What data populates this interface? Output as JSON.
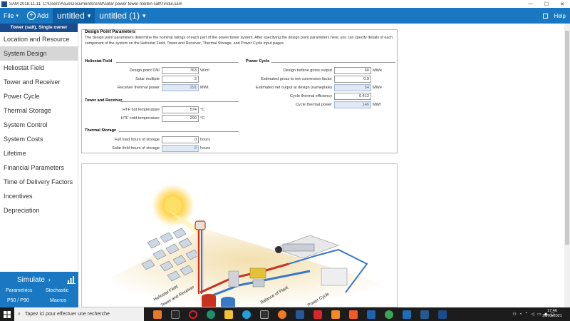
{
  "window": {
    "title": "SAM 2018.11.11: C:\\Users\\Asus\\Documents\\SAM\\solar power tower meiten salt\\Tiridul.sam"
  },
  "menubar": {
    "file_label": "File",
    "add_label": "Add",
    "cases": [
      "untitled",
      "untitled (1)"
    ],
    "help_label": "Help"
  },
  "sidebar": {
    "config_label": "Tower (salt), Single owner",
    "items": [
      {
        "label": "Location and Resource"
      },
      {
        "label": "System Design"
      },
      {
        "label": "Heliostat Field"
      },
      {
        "label": "Tower and Receiver"
      },
      {
        "label": "Power Cycle"
      },
      {
        "label": "Thermal Storage"
      },
      {
        "label": "System Control"
      },
      {
        "label": "System Costs"
      },
      {
        "label": "Lifetime"
      },
      {
        "label": "Financial Parameters"
      },
      {
        "label": "Time of Delivery Factors"
      },
      {
        "label": "Incentives"
      },
      {
        "label": "Depreciation"
      }
    ],
    "simulate_label": "Simulate",
    "parametrics_label": "Parametrics",
    "stochastic_label": "Stochastic",
    "p50p90_label": "P50 / P90",
    "macros_label": "Macros"
  },
  "design_point": {
    "title": "Design Point Parameters",
    "description": "The design point parameters determine the nominal ratings of each part of the power tower system. After specifying the design point parameters here, you can specify details of each component of the system on the Heliostat Field, Tower and Receiver, Thermal Storage, and Power Cycle input pages.",
    "heliostat_field": {
      "title": "Heliostat Field",
      "rows": [
        {
          "label": "Design point DNI",
          "value": "763",
          "unit": "W/m²",
          "calc": false
        },
        {
          "label": "Solar multiple",
          "value": "2",
          "unit": "",
          "calc": false
        },
        {
          "label": "Receiver thermal power",
          "value": "291",
          "unit": "MWt",
          "calc": true
        }
      ]
    },
    "tower_receiver": {
      "title": "Tower and Receiver",
      "rows": [
        {
          "label": "HTF hot temperature",
          "value": "574",
          "unit": "°C",
          "calc": false
        },
        {
          "label": "HTF cold temperature",
          "value": "290",
          "unit": "°C",
          "calc": false
        }
      ]
    },
    "thermal_storage": {
      "title": "Thermal Storage",
      "rows": [
        {
          "label": "Full load hours of storage",
          "value": "0",
          "unit": "hours",
          "calc": false
        },
        {
          "label": "Solar field hours of storage",
          "value": "0",
          "unit": "hours",
          "calc": true
        }
      ]
    },
    "power_cycle": {
      "title": "Power Cycle",
      "rows": [
        {
          "label": "Design turbine gross output",
          "value": "60",
          "unit": "MWe",
          "calc": false
        },
        {
          "label": "Estimated gross to net conversion factor",
          "value": "0.9",
          "unit": "",
          "calc": false
        },
        {
          "label": "Estimated net output at design (nameplate)",
          "value": "54",
          "unit": "MWe",
          "calc": true
        },
        {
          "label": "Cycle thermal efficiency",
          "value": "0.412",
          "unit": "",
          "calc": false
        },
        {
          "label": "Cycle thermal power",
          "value": "146",
          "unit": "MWt",
          "calc": true
        }
      ]
    }
  },
  "diagram": {
    "labels": {
      "heliostat": "Heliostat Field",
      "tower": "Tower and Receiver",
      "bop": "Balance of Plant",
      "cycle": "Power Cycle"
    }
  },
  "taskbar": {
    "search_placeholder": "Tapez ici pour effectuer une recherche",
    "time": "17:46",
    "date": "26/03/2021"
  },
  "colors": {
    "accent": "#1a78c2",
    "config_bar": "#1a4b8c",
    "calc_field": "#dfe8f5"
  }
}
